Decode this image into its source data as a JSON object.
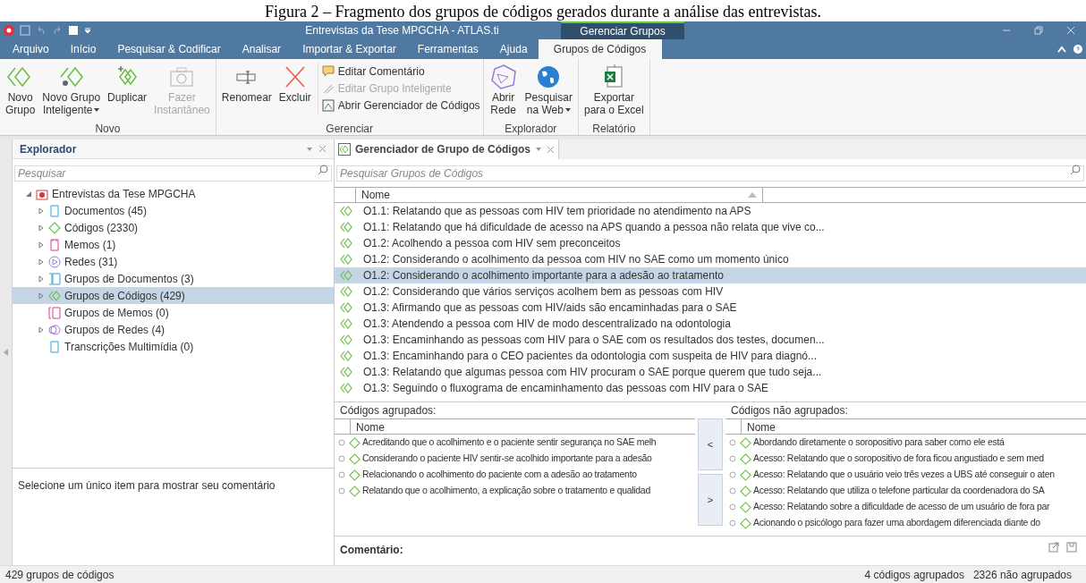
{
  "caption": "Figura 2 – Fragmento dos grupos de códigos gerados durante a análise das entrevistas.",
  "window": {
    "title": "Entrevistas da Tese MPGCHA - ATLAS.ti",
    "context_group": "Gerenciar Grupos"
  },
  "menu_tabs": [
    {
      "label": "Arquivo",
      "selected": false
    },
    {
      "label": "Início",
      "selected": false
    },
    {
      "label": "Pesquisar & Codificar",
      "selected": false
    },
    {
      "label": "Analisar",
      "selected": false
    },
    {
      "label": "Importar & Exportar",
      "selected": false
    },
    {
      "label": "Ferramentas",
      "selected": false
    },
    {
      "label": "Ajuda",
      "selected": false
    },
    {
      "label": "Grupos de Códigos",
      "selected": true
    }
  ],
  "ribbon": [
    {
      "label": "Novo",
      "items": [
        {
          "kind": "large",
          "lines": [
            "Novo",
            "Grupo"
          ],
          "disabled": false
        },
        {
          "kind": "large",
          "lines": [
            "Novo Grupo",
            "Inteligente"
          ],
          "disabled": false,
          "dropdown": true
        },
        {
          "kind": "large",
          "lines": [
            "Duplicar"
          ],
          "disabled": false
        },
        {
          "kind": "large",
          "lines": [
            "Fazer",
            "Instantâneo"
          ],
          "disabled": true
        }
      ]
    },
    {
      "label": "Gerenciar",
      "items": [
        {
          "kind": "large",
          "lines": [
            "Renomear"
          ],
          "disabled": false
        },
        {
          "kind": "large",
          "lines": [
            "Excluir"
          ],
          "disabled": false
        },
        {
          "kind": "small",
          "lines": [
            "Editar Comentário"
          ],
          "disabled": false
        },
        {
          "kind": "small",
          "lines": [
            "Editar Grupo Inteligente"
          ],
          "disabled": true
        },
        {
          "kind": "small",
          "lines": [
            "Abrir Gerenciador de Códigos"
          ],
          "disabled": false
        }
      ]
    },
    {
      "label": "Explorador",
      "items": [
        {
          "kind": "large",
          "lines": [
            "Abrir",
            "Rede"
          ],
          "disabled": false
        },
        {
          "kind": "large",
          "lines": [
            "Pesquisar",
            "na Web"
          ],
          "disabled": false,
          "dropdown": true
        }
      ]
    },
    {
      "label": "Relatório",
      "items": [
        {
          "kind": "large",
          "lines": [
            "Exportar",
            "para o Excel"
          ],
          "disabled": false
        }
      ]
    }
  ],
  "explorer": {
    "title": "Explorador",
    "search_placeholder": "Pesquisar",
    "tree": [
      {
        "label": "Entrevistas da Tese MPGCHA",
        "expanded": true,
        "selected": false,
        "children": [
          {
            "label": "Documentos (45)",
            "expanded": false,
            "selected": false
          },
          {
            "label": "Códigos (2330)",
            "expanded": false,
            "selected": false
          },
          {
            "label": "Memos (1)",
            "expanded": false,
            "selected": false
          },
          {
            "label": "Redes (31)",
            "expanded": false,
            "selected": false
          },
          {
            "label": "Grupos de Documentos (3)",
            "expanded": false,
            "selected": false
          },
          {
            "label": "Grupos de Códigos (429)",
            "expanded": false,
            "selected": true
          },
          {
            "label": "Grupos de Memos (0)",
            "selected": false
          },
          {
            "label": "Grupos de Redes (4)",
            "expanded": false,
            "selected": false
          },
          {
            "label": "Transcrições Multimídia (0)",
            "selected": false
          }
        ]
      }
    ],
    "comment_hint": "Selecione um único item para mostrar seu comentário"
  },
  "manager": {
    "tab_title": "Gerenciador de Grupo de Códigos",
    "search_placeholder": "Pesquisar Grupos de Códigos",
    "column": "Nome",
    "rows": [
      {
        "text": "O1.1: Relatando que as pessoas com HIV tem prioridade no atendimento na APS",
        "selected": false
      },
      {
        "text": "O1.1: Relatando que há dificuldade de acesso na APS quando a pessoa não relata que vive co...",
        "selected": false
      },
      {
        "text": "O1.2: Acolhendo a pessoa com HIV sem preconceitos",
        "selected": false
      },
      {
        "text": "O1.2: Considerando o acolhimento da pessoa com HIV no SAE como um momento único",
        "selected": false
      },
      {
        "text": "O1.2: Considerando o acolhimento importante para a adesão ao tratamento",
        "selected": true
      },
      {
        "text": "O1.2: Considerando que vários serviços acolhem bem as pessoas com HIV",
        "selected": false
      },
      {
        "text": "O1.3: Afirmando que as pessoas com HIV/aids são encaminhadas para o SAE",
        "selected": false
      },
      {
        "text": "O1.3: Atendendo a pessoa com HIV de modo descentralizado na odontologia",
        "selected": false
      },
      {
        "text": "O1.3: Encaminhando as pessoas com HIV para o SAE com os resultados dos testes, documen...",
        "selected": false
      },
      {
        "text": "O1.3: Encaminhando para o CEO pacientes da odontologia com suspeita de HIV para diagnó...",
        "selected": false
      },
      {
        "text": "O1.3: Relatando que algumas pessoa com HIV procuram o SAE porque querem que tudo seja...",
        "selected": false
      },
      {
        "text": "O1.3: Seguindo o fluxograma de encaminhamento das pessoas com HIV para o SAE",
        "selected": false
      }
    ]
  },
  "grouped": {
    "label": "Códigos agrupados:",
    "column": "Nome",
    "items": [
      "Acreditando que o acolhimento e o paciente sentir segurança no SAE melh",
      "Considerando o paciente HIV sentir-se acolhido importante para a adesão",
      "Relacionando o acolhimento do paciente com a adesão ao tratamento",
      "Relatando que o acolhimento, a explicação sobre o tratamento e qualidad"
    ]
  },
  "move_buttons": [
    "<",
    ">"
  ],
  "ungrouped": {
    "label": "Códigos não agrupados:",
    "column": "Nome",
    "items": [
      "Abordando diretamente o soropositivo para saber como ele está",
      "Acesso: Relatando que o soropositivo de fora ficou angustiado e sem med",
      "Acesso: Relatando que o usuário veio três vezes a UBS até conseguir o aten",
      "Acesso: Relatando que utiliza o telefone particular da coordenadora do SA",
      "Acesso: Relatando sobre a dificuldade de acesso de um usuário de fora par",
      "Acionando o psicólogo para fazer uma abordagem diferenciada diante do"
    ]
  },
  "comment": {
    "label": "Comentário:"
  },
  "status_bar": {
    "left": "429 grupos de códigos",
    "right": [
      "4 códigos agrupados",
      "2326 não agrupados"
    ]
  }
}
